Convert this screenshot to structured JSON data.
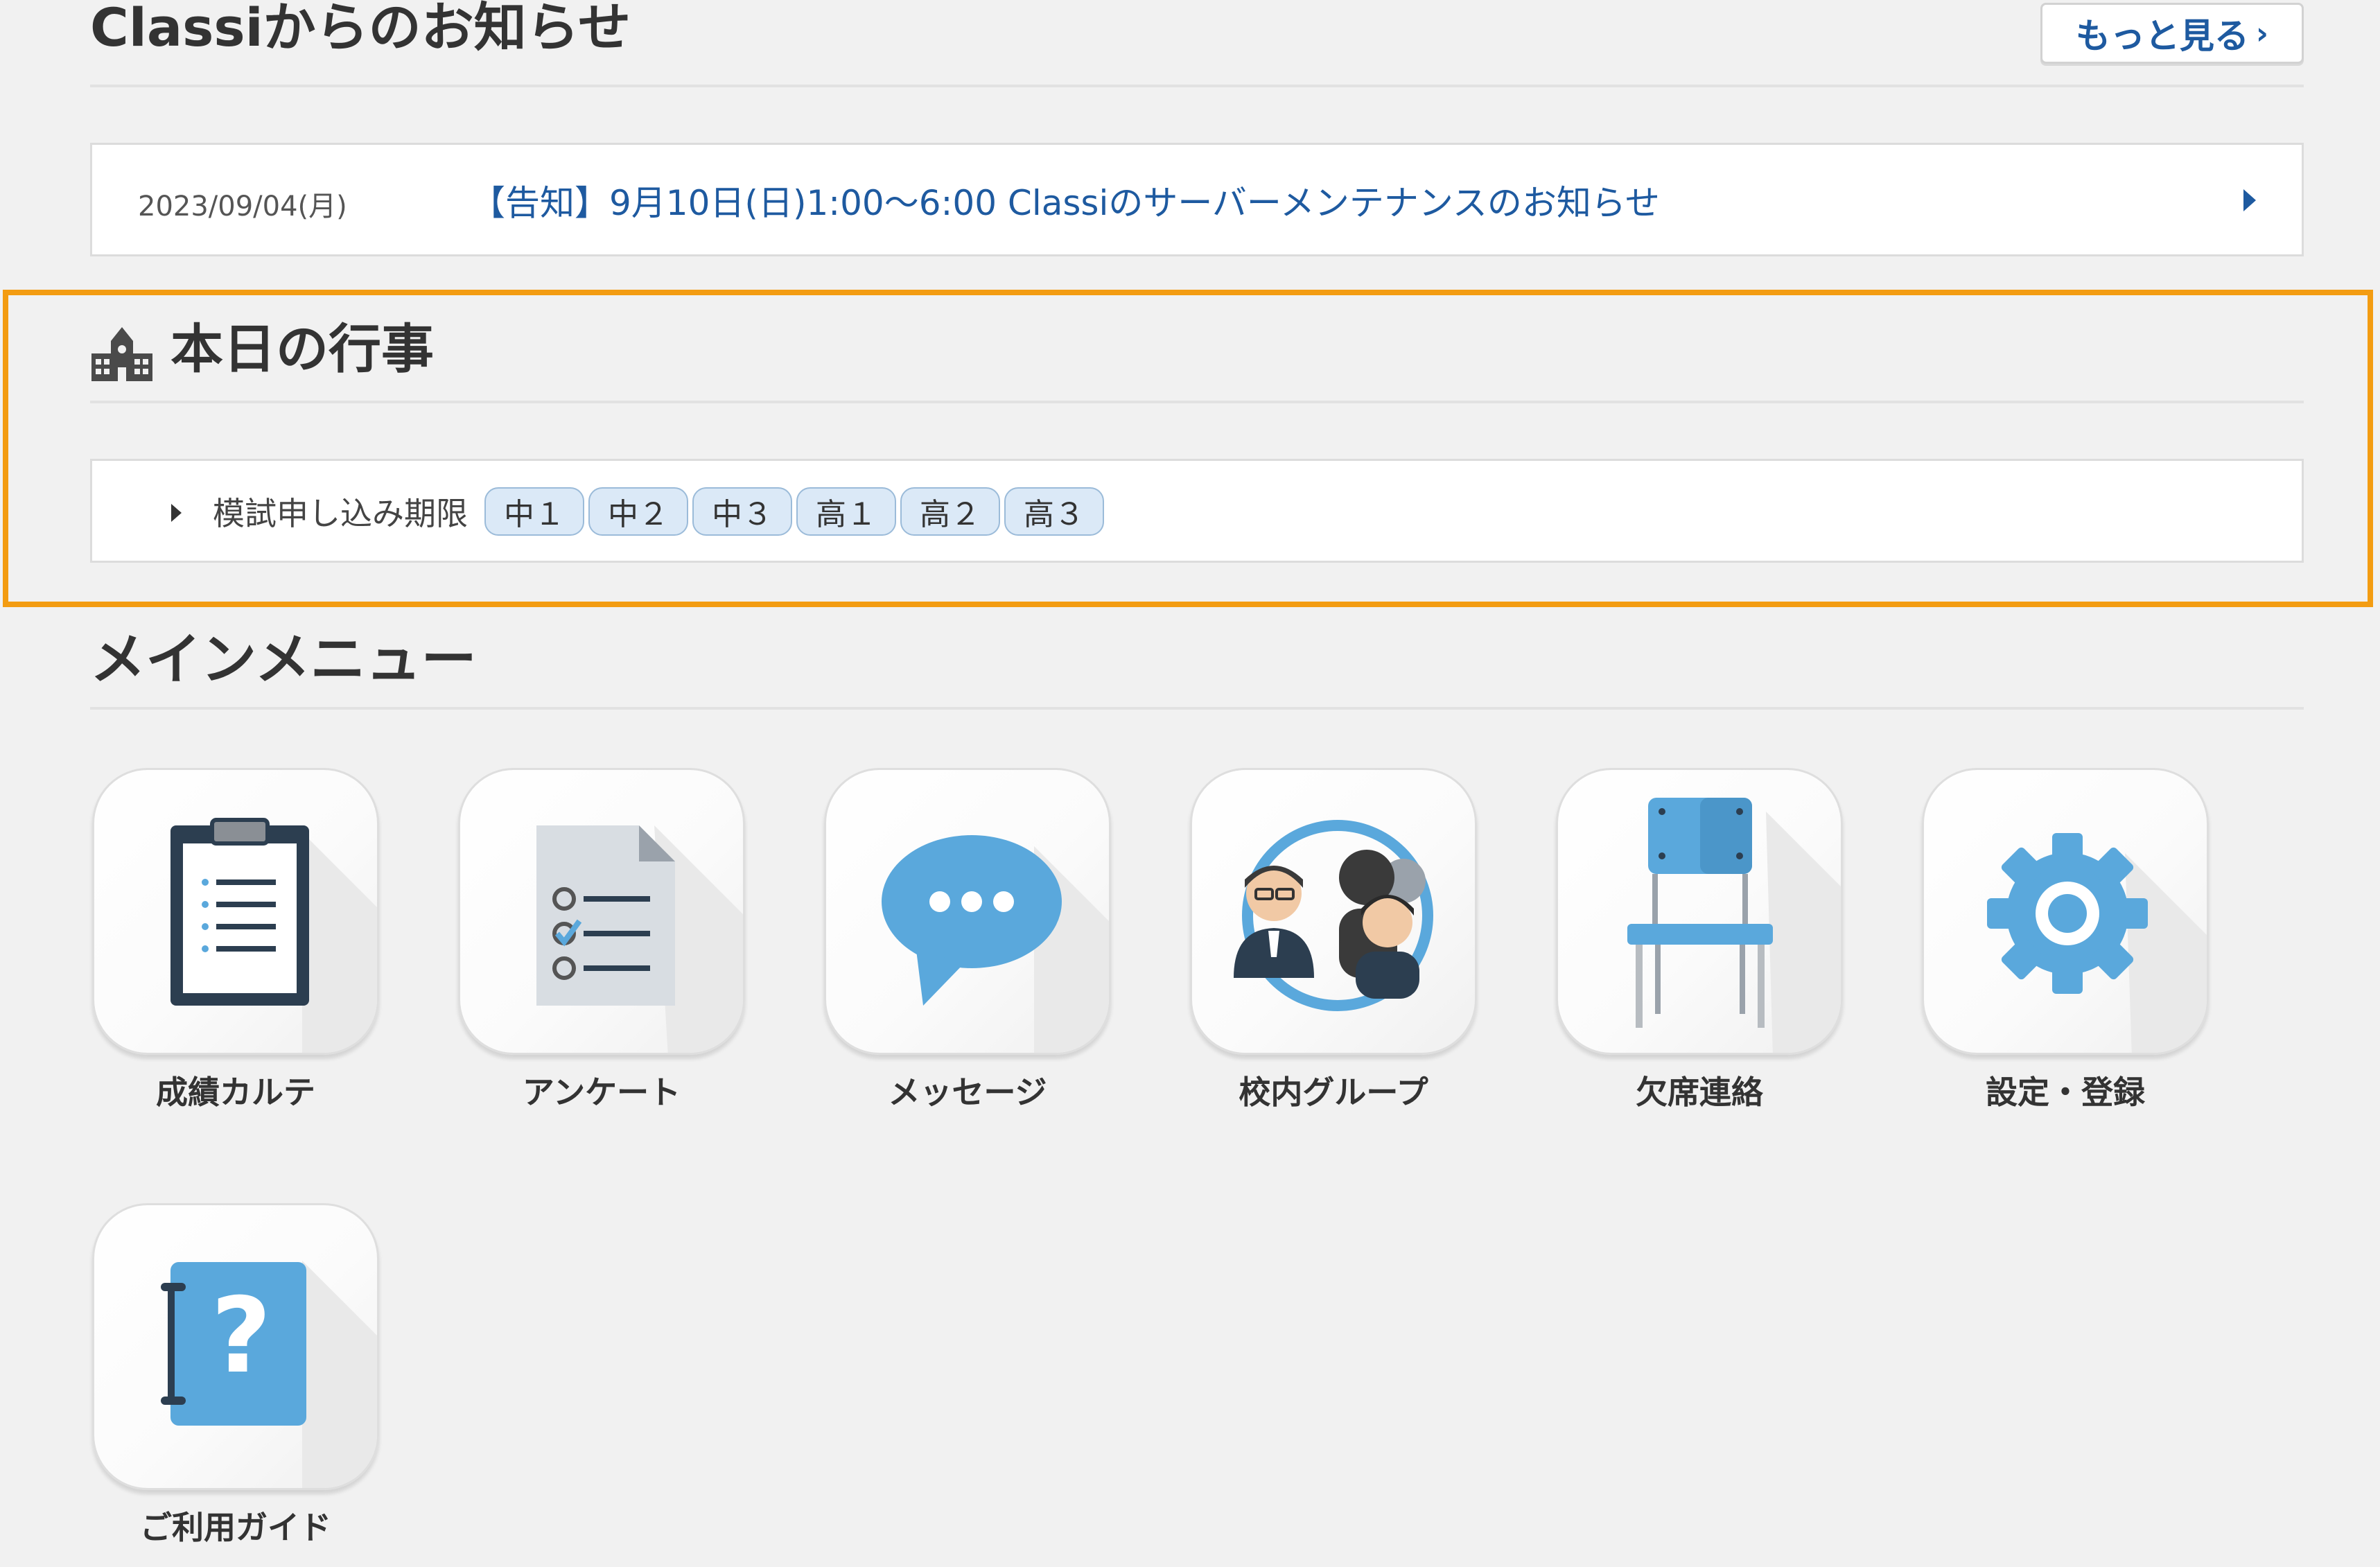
{
  "notices": {
    "title": "Classiからのお知らせ",
    "more_label": "もっと見る",
    "items": [
      {
        "date": "2023/09/04(月)",
        "text": "【告知】9月10日(日)1:00～6:00 Classiのサーバーメンテナンスのお知らせ"
      }
    ]
  },
  "today_events": {
    "title": "本日の行事",
    "items": [
      {
        "label": "模試申し込み期限",
        "grades": [
          "中１",
          "中２",
          "中３",
          "高１",
          "高２",
          "高３"
        ]
      }
    ]
  },
  "main_menu": {
    "title": "メインメニュー",
    "items": [
      {
        "label": "成績カルテ",
        "icon": "clipboard-icon"
      },
      {
        "label": "アンケート",
        "icon": "survey-checklist-icon"
      },
      {
        "label": "メッセージ",
        "icon": "speech-bubble-icon"
      },
      {
        "label": "校内グループ",
        "icon": "group-people-icon"
      },
      {
        "label": "欠席連絡",
        "icon": "chair-icon"
      },
      {
        "label": "設定・登録",
        "icon": "gear-icon"
      },
      {
        "label": "ご利用ガイド",
        "icon": "help-book-icon"
      }
    ]
  },
  "colors": {
    "link": "#1e5aa0",
    "highlight_border": "#f39c12",
    "tag_bg": "#dbe9f7",
    "icon_blue": "#5aa8dc"
  }
}
